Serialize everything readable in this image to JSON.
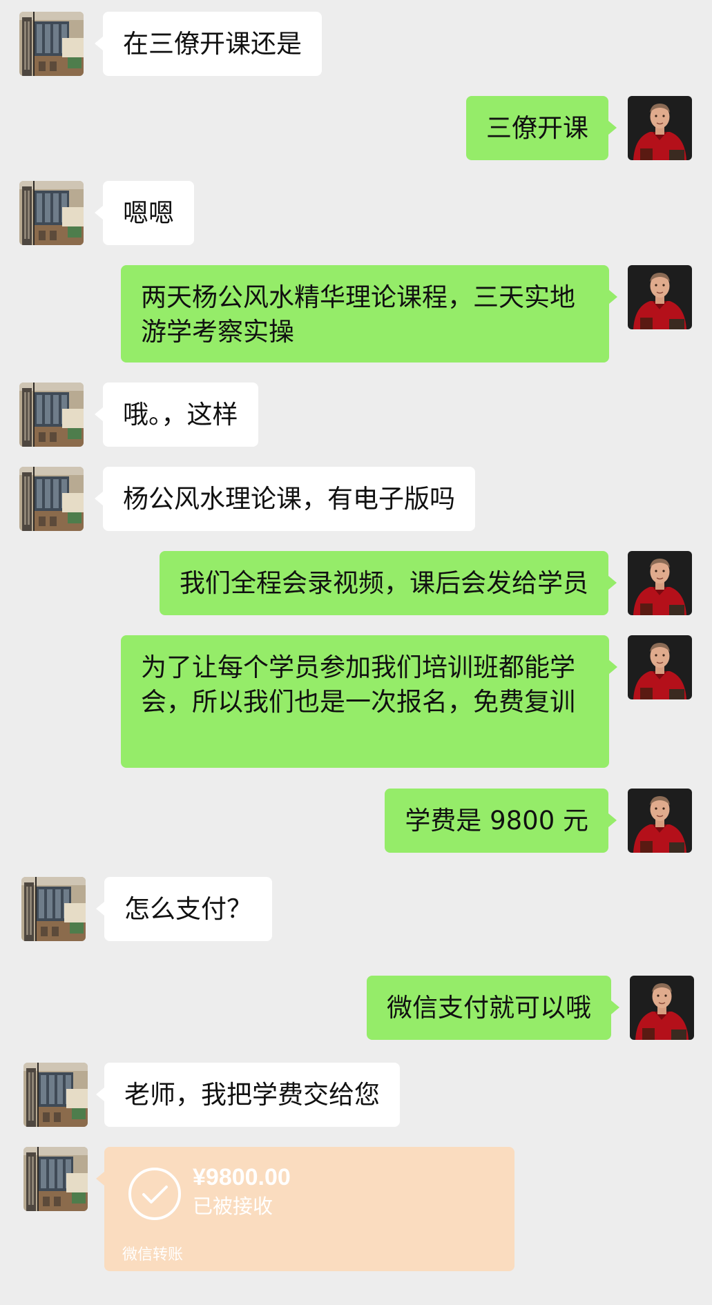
{
  "messages": [
    {
      "text": "在三僚开课还是"
    },
    {
      "text": "三僚开课"
    },
    {
      "text": "嗯嗯"
    },
    {
      "text": "两天杨公风水精华理论课程，三天实地游学考察实操"
    },
    {
      "text": "哦。，这样"
    },
    {
      "text": "杨公风水理论课，有电子版吗"
    },
    {
      "text": "我们全程会录视频，课后会发给学员"
    },
    {
      "text": "为了让每个学员参加我们培训班都能学会，所以我们也是一次报名，免费复训"
    },
    {
      "text": "学费是 9800 元"
    },
    {
      "text": "怎么支付？"
    },
    {
      "text": "微信支付就可以哦"
    },
    {
      "text": "老师，我把学费交给您"
    }
  ],
  "transfer": {
    "amount": "¥9800.00",
    "status": "已被接收",
    "label": "微信转账",
    "icon": "check-circle-icon"
  },
  "avatars": {
    "contact": "building-avatar",
    "self": "red-jacket-man-avatar"
  },
  "colors": {
    "background": "#ededed",
    "incoming_bubble": "#ffffff",
    "outgoing_bubble": "#95ec69",
    "transfer_card": "#fadcbf",
    "text": "#111111"
  }
}
